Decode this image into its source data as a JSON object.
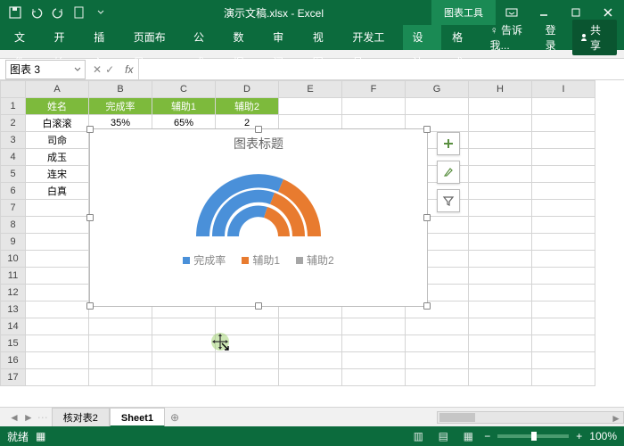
{
  "titlebar": {
    "filename": "演示文稿.xlsx - Excel",
    "context_tab": "图表工具"
  },
  "ribbon": {
    "tabs": [
      "文件",
      "开始",
      "插入",
      "页面布局",
      "公式",
      "数据",
      "审阅",
      "视图",
      "开发工具"
    ],
    "context_tabs": [
      "设计",
      "格式"
    ],
    "tell_me": "告诉我...",
    "login": "登录",
    "share": "共享"
  },
  "namebox": {
    "value": "图表 3"
  },
  "grid": {
    "columns": [
      "A",
      "B",
      "C",
      "D",
      "E",
      "F",
      "G",
      "H",
      "I"
    ],
    "rows": 17,
    "header_row": [
      "姓名",
      "完成率",
      "辅助1",
      "辅助2"
    ],
    "data": [
      [
        "白滚滚",
        "35%",
        "65%",
        "2"
      ],
      [
        "司命",
        "",
        "",
        ""
      ],
      [
        "成玉",
        "",
        "",
        ""
      ],
      [
        "连宋",
        "",
        "",
        ""
      ],
      [
        "白真",
        "",
        "",
        ""
      ]
    ]
  },
  "chart": {
    "title": "图表标题",
    "legend": [
      "完成率",
      "辅助1",
      "辅助2"
    ],
    "colors": {
      "s1": "#4a90d9",
      "s2": "#e87b2f",
      "s3": "#a6a6a6"
    }
  },
  "chart_data": {
    "type": "pie",
    "note": "multi-ring semi doughnut (gauge style)",
    "series": [
      {
        "name": "完成率",
        "values": [
          35
        ]
      },
      {
        "name": "辅助1",
        "values": [
          65
        ]
      },
      {
        "name": "辅助2",
        "values": [
          2
        ]
      }
    ],
    "categories": [
      "白滚滚"
    ],
    "title": "图表标题"
  },
  "sheets": {
    "tabs": [
      "核对表2",
      "Sheet1"
    ],
    "active": 1
  },
  "status": {
    "ready": "就绪",
    "zoom": "100%"
  }
}
